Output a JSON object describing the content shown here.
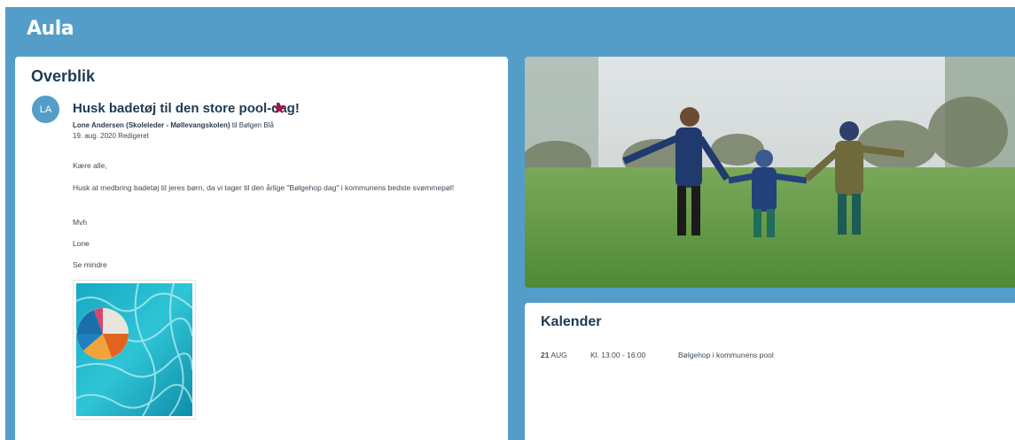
{
  "app": {
    "logo": "Aula"
  },
  "overview": {
    "title": "Overblik",
    "post": {
      "avatar_initials": "LA",
      "title": "Husk badetøj til den store pool-dag!",
      "author": "Lone Andersen (Skoleleder - Møllevangskolen)",
      "recipient_prefix": "til",
      "recipient": "Bølgen Blå",
      "date": "19. aug. 2020",
      "edited": "Redigeret",
      "greeting": "Kære alle,",
      "message": "Husk at medbring badetøj til jeres børn, da vi tager til den årlige \"Bølgehop dag\" i kommunens bedste svømmepøl!",
      "closing": "Mvh",
      "signature": "Lone",
      "see_less": "Se mindre",
      "star_color": "#a3134d"
    }
  },
  "calendar": {
    "title": "Kalender",
    "events": [
      {
        "day": "21",
        "month": "AUG",
        "time": "Kl. 13:00 - 16:00",
        "title": "Bølgehop i kommunens pool"
      }
    ]
  },
  "colors": {
    "brand": "#549dc9",
    "heading": "#1d3a52"
  }
}
